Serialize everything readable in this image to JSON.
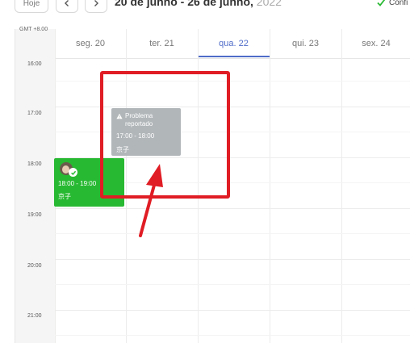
{
  "toolbar": {
    "today_label": "Hoje",
    "range_text": "20 de junho - 26 de junho,",
    "range_year": "2022",
    "confirm_label": "Confi"
  },
  "calendar": {
    "timezone": "GMT +8.00",
    "days": [
      {
        "label": "seg. 20"
      },
      {
        "label": "ter. 21"
      },
      {
        "label": "qua. 22",
        "active": true
      },
      {
        "label": "qui. 23"
      },
      {
        "label": "sex. 24"
      }
    ],
    "hours": [
      "16:00",
      "17:00",
      "18:00",
      "19:00",
      "20:00",
      "21:00"
    ]
  },
  "events": {
    "problem": {
      "title": "Problema reportado",
      "time": "17:00 - 18:00",
      "person": "京子",
      "color": "#b1b6b9",
      "icon": "warning-icon"
    },
    "confirmed": {
      "time": "18:00 - 19:00",
      "person": "京子",
      "color": "#28b932",
      "icon": "check-icon"
    }
  },
  "colors": {
    "accent": "#4f6cc8",
    "annotation": "#e01c24",
    "confirm": "#28b932"
  }
}
